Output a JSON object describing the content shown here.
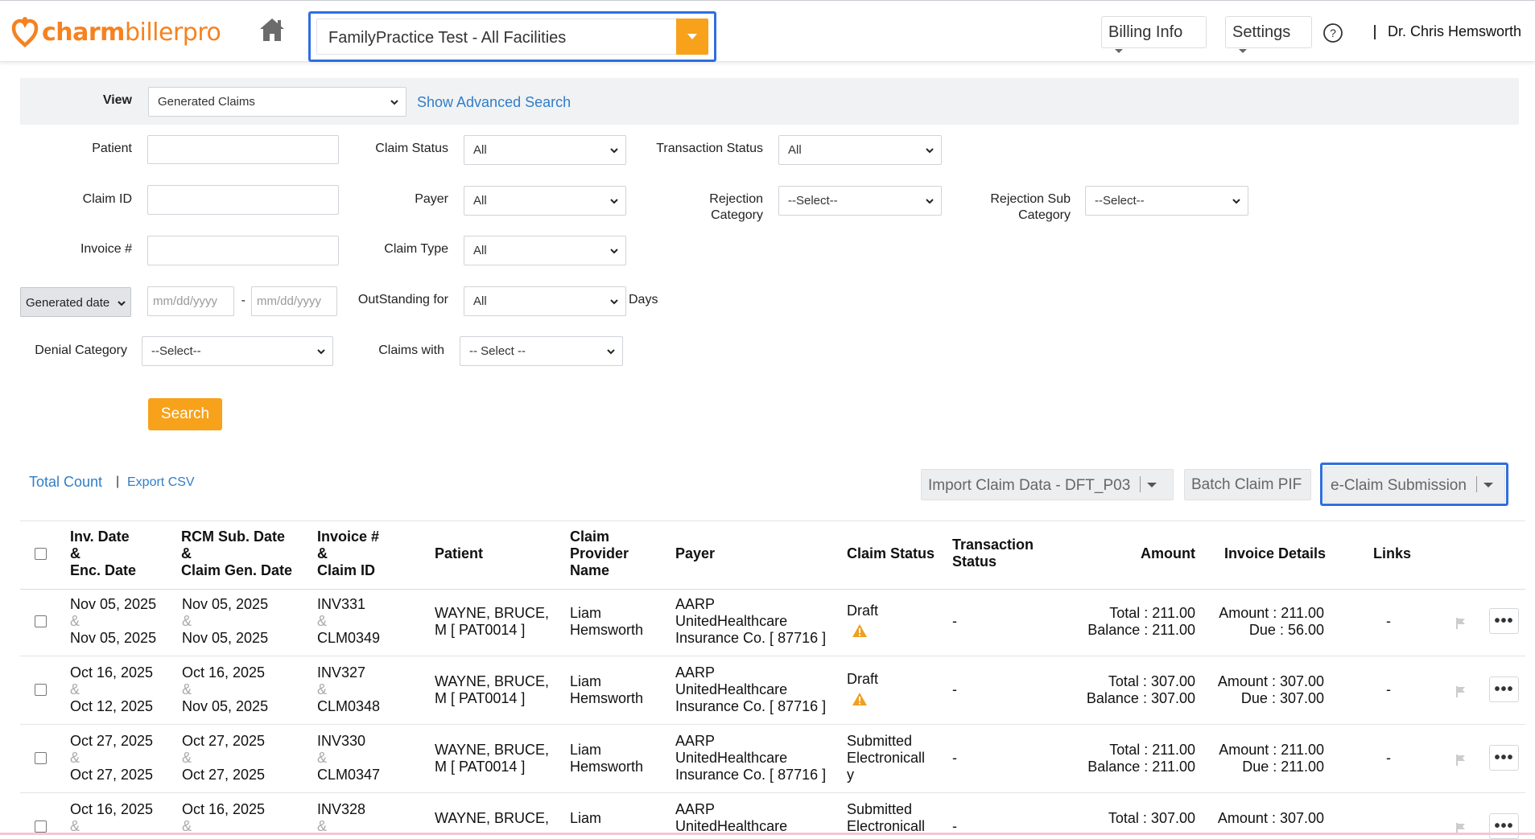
{
  "header": {
    "logo_part1": "charm",
    "logo_part2": "billerpro",
    "facility": "FamilyPractice Test - All Facilities",
    "billing_info": "Billing Info",
    "settings": "Settings",
    "user_name": "Dr. Chris Hemsworth"
  },
  "filters": {
    "view_label": "View",
    "view_value": "Generated Claims",
    "advanced_search": "Show Advanced Search",
    "patient_label": "Patient",
    "claim_id_label": "Claim ID",
    "invoice_label": "Invoice #",
    "claim_status_label": "Claim Status",
    "claim_status_value": "All",
    "payer_label": "Payer",
    "payer_value": "All",
    "claim_type_label": "Claim Type",
    "claim_type_value": "All",
    "transaction_status_label": "Transaction Status",
    "transaction_status_value": "All",
    "rejection_category_label_1": "Rejection",
    "rejection_category_label_2": "Category",
    "rejection_category_value": "--Select--",
    "rejection_sub_label_1": "Rejection Sub",
    "rejection_sub_label_2": "Category",
    "rejection_sub_value": "--Select--",
    "date_type": "Generated date",
    "date_from_placeholder": "mm/dd/yyyy",
    "date_to_placeholder": "mm/dd/yyyy",
    "date_dash": "-",
    "outstanding_label": "OutStanding for",
    "outstanding_value": "All",
    "days_label": "Days",
    "denial_label": "Denial Category",
    "denial_value": "--Select--",
    "claims_with_label": "Claims with",
    "claims_with_value": "-- Select --",
    "search_button": "Search"
  },
  "toolbar": {
    "total_count": "Total Count",
    "separator": "|",
    "export_csv": "Export CSV",
    "import_claim": "Import Claim Data - DFT_P03",
    "batch_claim": "Batch Claim PIF",
    "eclaim": "e-Claim Submission"
  },
  "table": {
    "headers": {
      "inv_date": [
        "Inv. Date",
        "&",
        "Enc. Date"
      ],
      "rcm_date": [
        "RCM Sub. Date",
        "&",
        "Claim Gen. Date"
      ],
      "invoice": [
        "Invoice #",
        "&",
        "Claim ID"
      ],
      "patient": "Patient",
      "provider": [
        "Claim",
        "Provider",
        "Name"
      ],
      "payer": "Payer",
      "claim_status": "Claim Status",
      "transaction_status": [
        "Transaction",
        "Status"
      ],
      "amount": "Amount",
      "invoice_details": "Invoice Details",
      "links": "Links"
    },
    "amp": "&",
    "rows": [
      {
        "inv_date": "Nov 05, 2025",
        "enc_date": "Nov 05, 2025",
        "rcm_date": "Nov 05, 2025",
        "gen_date": "Nov 05, 2025",
        "invoice": "INV331",
        "claim_id": "CLM0349",
        "patient_1": "WAYNE, BRUCE,",
        "patient_2": "M [ PAT0014 ]",
        "provider_1": "Liam",
        "provider_2": "Hemsworth",
        "payer_1": "AARP",
        "payer_2": "UnitedHealthcare",
        "payer_3": "Insurance Co. [ 87716 ]",
        "status_1": "Draft",
        "status_2": "",
        "status_3": "",
        "transaction": "-",
        "total": "Total : 211.00",
        "balance": "Balance : 211.00",
        "inv_amount": "Amount : 211.00",
        "due": "Due : 56.00",
        "links": "-"
      },
      {
        "inv_date": "Oct 16, 2025",
        "enc_date": "Oct 12, 2025",
        "rcm_date": "Oct 16, 2025",
        "gen_date": "Nov 05, 2025",
        "invoice": "INV327",
        "claim_id": "CLM0348",
        "patient_1": "WAYNE, BRUCE,",
        "patient_2": "M [ PAT0014 ]",
        "provider_1": "Liam",
        "provider_2": "Hemsworth",
        "payer_1": "AARP",
        "payer_2": "UnitedHealthcare",
        "payer_3": "Insurance Co. [ 87716 ]",
        "status_1": "Draft",
        "status_2": "",
        "status_3": "",
        "transaction": "-",
        "total": "Total : 307.00",
        "balance": "Balance : 307.00",
        "inv_amount": "Amount : 307.00",
        "due": "Due : 307.00",
        "links": "-"
      },
      {
        "inv_date": "Oct 27, 2025",
        "enc_date": "Oct 27, 2025",
        "rcm_date": "Oct 27, 2025",
        "gen_date": "Oct 27, 2025",
        "invoice": "INV330",
        "claim_id": "CLM0347",
        "patient_1": "WAYNE, BRUCE,",
        "patient_2": "M [ PAT0014 ]",
        "provider_1": "Liam",
        "provider_2": "Hemsworth",
        "payer_1": "AARP",
        "payer_2": "UnitedHealthcare",
        "payer_3": "Insurance Co. [ 87716 ]",
        "status_1": "Submitted",
        "status_2": "Electronicall",
        "status_3": "y",
        "transaction": "-",
        "total": "Total : 211.00",
        "balance": "Balance : 211.00",
        "inv_amount": "Amount : 211.00",
        "due": "Due : 211.00",
        "links": "-"
      },
      {
        "inv_date": "Oct 16, 2025",
        "enc_date": "",
        "rcm_date": "Oct 16, 2025",
        "gen_date": "",
        "invoice": "INV328",
        "claim_id": "",
        "patient_1": "WAYNE, BRUCE,",
        "patient_2": "",
        "provider_1": "Liam",
        "provider_2": "",
        "payer_1": "AARP",
        "payer_2": "UnitedHealthcare",
        "payer_3": "",
        "status_1": "Submitted",
        "status_2": "Electronicall",
        "status_3": "",
        "transaction": "-",
        "total": "Total : 307.00",
        "balance": "",
        "inv_amount": "Amount : 307.00",
        "due": "",
        "links": ""
      }
    ]
  },
  "colors": {
    "brand_orange": "#f58220",
    "accent_orange": "#f7a21a",
    "focus_blue": "#2f6fe0",
    "link_blue": "#2f7ec8",
    "warning": "#f0a020"
  },
  "icons": [
    "home-icon",
    "chevron-down-icon",
    "help-icon",
    "warning-icon",
    "flag-icon",
    "more-icon"
  ]
}
